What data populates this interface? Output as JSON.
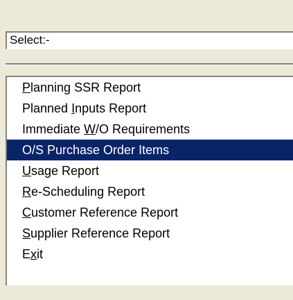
{
  "select_field": {
    "value": "Select:-"
  },
  "menu": {
    "items": [
      {
        "pre": "",
        "mnemonic": "P",
        "post": "lanning SSR Report",
        "selected": false
      },
      {
        "pre": "Planned ",
        "mnemonic": "I",
        "post": "nputs Report",
        "selected": false
      },
      {
        "pre": "Immediate ",
        "mnemonic": "W",
        "post": "/O Requirements",
        "selected": false
      },
      {
        "pre": "O/S Purchase Order Items",
        "mnemonic": "",
        "post": "",
        "selected": true
      },
      {
        "pre": "",
        "mnemonic": "U",
        "post": "sage Report",
        "selected": false
      },
      {
        "pre": "",
        "mnemonic": "R",
        "post": "e-Scheduling Report",
        "selected": false
      },
      {
        "pre": "",
        "mnemonic": "C",
        "post": "ustomer Reference Report",
        "selected": false
      },
      {
        "pre": "",
        "mnemonic": "S",
        "post": "upplier Reference Report",
        "selected": false
      },
      {
        "pre": "E",
        "mnemonic": "x",
        "post": "it",
        "selected": false
      }
    ]
  },
  "colors": {
    "window_bg": "#ECE9D8",
    "selection_bg": "#0A246A",
    "selection_fg": "#FFFFFF"
  }
}
